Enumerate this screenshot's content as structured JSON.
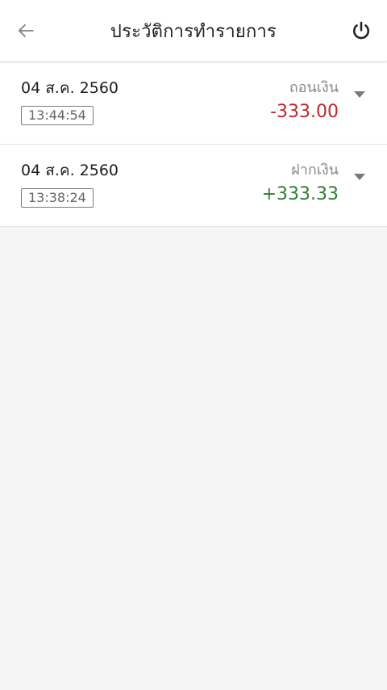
{
  "header": {
    "title": "ประวัติการทำรายการ"
  },
  "transactions": [
    {
      "date": "04 ส.ค. 2560",
      "time": "13:44:54",
      "type": "ถอนเงิน",
      "amount": "-333.00",
      "color": "#c0272d"
    },
    {
      "date": "04 ส.ค. 2560",
      "time": "13:38:24",
      "type": "ฝากเงิน",
      "amount": "+333.33",
      "color": "#2e7d32"
    }
  ],
  "colors": {
    "background": "#f5f5f5",
    "withdraw": "#c0272d",
    "deposit": "#2e7d32"
  },
  "icons": {
    "back": "arrow-left-icon",
    "power": "power-icon",
    "expand": "chevron-down-icon"
  }
}
